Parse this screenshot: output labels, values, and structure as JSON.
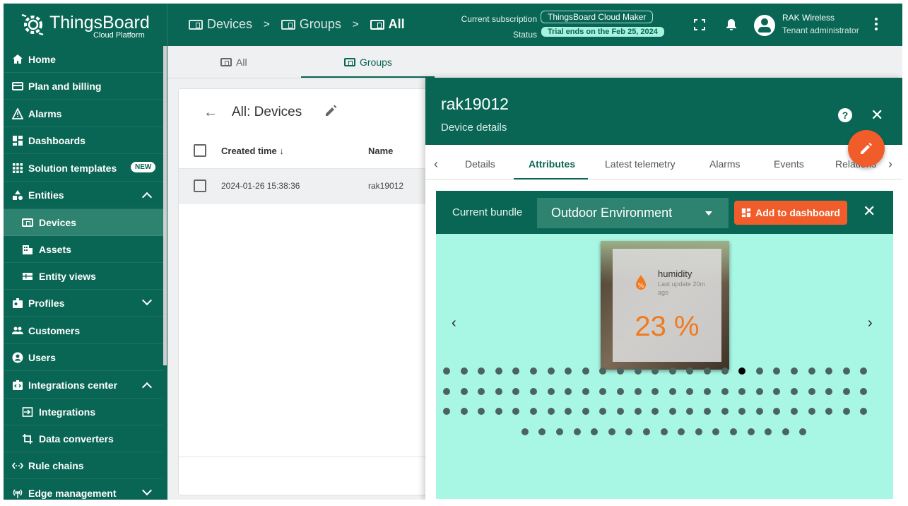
{
  "app": {
    "logo_name": "ThingsBoard",
    "logo_sub": "Cloud Platform"
  },
  "breadcrumb": [
    "Devices",
    "Groups",
    "All"
  ],
  "subscription": {
    "label": "Current subscription",
    "plan": "ThingsBoard Cloud Maker",
    "status_label": "Status",
    "status": "Trial ends on the Feb 25, 2024"
  },
  "user": {
    "name": "RAK Wireless",
    "role": "Tenant administrator"
  },
  "sidebar": {
    "items": [
      {
        "label": "Home",
        "icon": "home-icon"
      },
      {
        "label": "Plan and billing",
        "icon": "billing-icon"
      },
      {
        "label": "Alarms",
        "icon": "alarm-icon"
      },
      {
        "label": "Dashboards",
        "icon": "dashboard-icon"
      },
      {
        "label": "Solution templates",
        "icon": "templates-icon",
        "badge": "NEW"
      },
      {
        "label": "Entities",
        "icon": "entities-icon"
      },
      {
        "label": "Devices",
        "icon": "devices-icon"
      },
      {
        "label": "Assets",
        "icon": "assets-icon"
      },
      {
        "label": "Entity views",
        "icon": "entity-views-icon"
      },
      {
        "label": "Profiles",
        "icon": "profiles-icon"
      },
      {
        "label": "Customers",
        "icon": "customers-icon"
      },
      {
        "label": "Users",
        "icon": "users-icon"
      },
      {
        "label": "Integrations center",
        "icon": "integrations-center-icon"
      },
      {
        "label": "Integrations",
        "icon": "integrations-icon"
      },
      {
        "label": "Data converters",
        "icon": "data-converters-icon"
      },
      {
        "label": "Rule chains",
        "icon": "rule-chains-icon"
      },
      {
        "label": "Edge management",
        "icon": "edge-icon"
      }
    ]
  },
  "main_tabs": [
    "All",
    "Groups"
  ],
  "devices_panel": {
    "title": "All: Devices",
    "columns": [
      "Created time",
      "Name"
    ],
    "rows": [
      {
        "created": "2024-01-26 15:38:36",
        "name": "rak19012"
      }
    ]
  },
  "drawer": {
    "title": "rak19012",
    "subtitle": "Device details",
    "tabs": [
      "Details",
      "Attributes",
      "Latest telemetry",
      "Alarms",
      "Events",
      "Relations"
    ],
    "active_tab": "Attributes",
    "bundle_label": "Current bundle",
    "bundle_value": "Outdoor Environment",
    "add_button": "Add to dashboard",
    "widget": {
      "title": "humidity",
      "updated": "Last update 20m ago",
      "value": "23 %"
    },
    "pagination": {
      "rows": [
        25,
        25,
        25,
        17
      ],
      "active_index": 17
    }
  },
  "colors": {
    "primary": "#0a6654",
    "accent": "#f15d2a",
    "bundle_bg": "#a8f6e4",
    "value": "#f07a1f"
  }
}
